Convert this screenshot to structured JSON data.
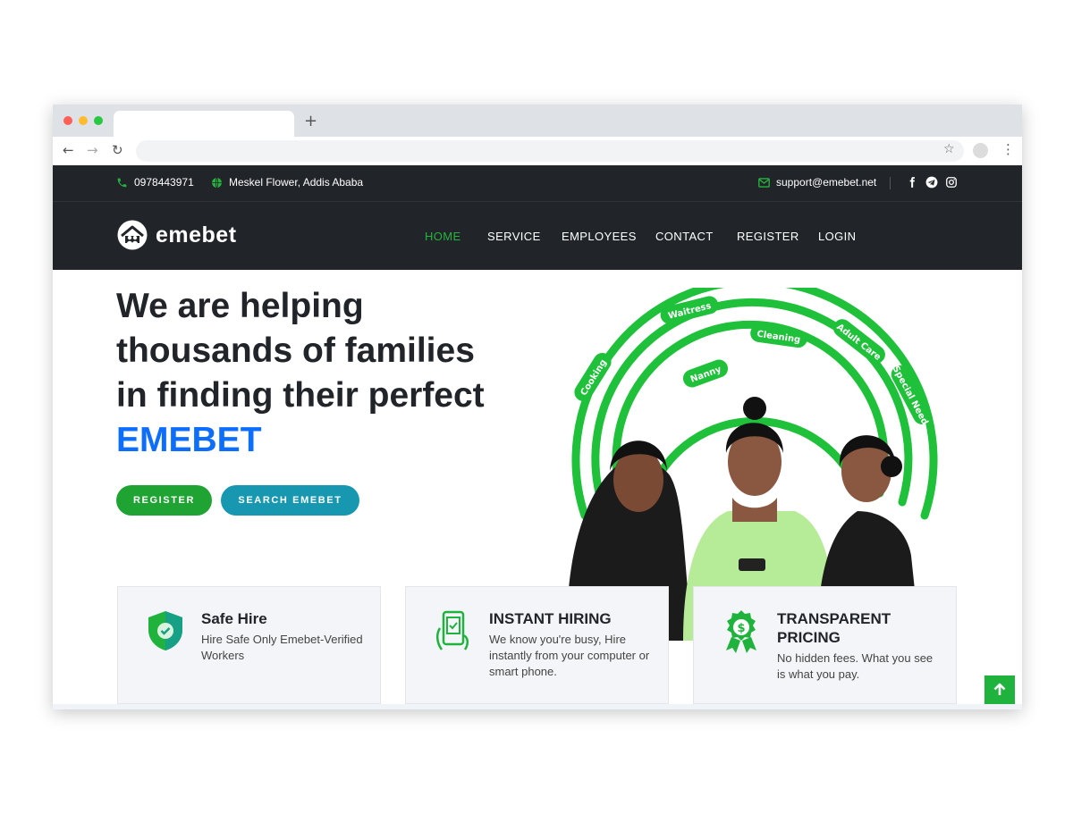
{
  "browser": {
    "new_tab": "+",
    "back": "←",
    "forward": "→",
    "reload": "↻",
    "bookmark": "☆",
    "menu": "⋮"
  },
  "topbar": {
    "phone": "0978443971",
    "location": "Meskel Flower, Addis Ababa",
    "email": "support@emebet.net",
    "social_icons": [
      "facebook-icon",
      "telegram-icon",
      "instagram-icon"
    ]
  },
  "nav": {
    "logo": "emebet",
    "items": [
      "HOME",
      "SERVICE",
      "EMPLOYEES",
      "CONTACT",
      "REGISTER",
      "LOGIN"
    ],
    "active": "HOME"
  },
  "hero": {
    "title_lines": [
      "We are helping",
      "thousands of families",
      "in finding their perfect"
    ],
    "title_brand": "EMEBET",
    "buttons": {
      "register": "REGISTER",
      "search": "SEARCH EMEBET"
    },
    "ring_labels": [
      "Waitress",
      "Cleaning",
      "Adult Care",
      "Cooking",
      "Nanny",
      "Special Need"
    ]
  },
  "features": [
    {
      "title": "Safe Hire",
      "desc": "Hire Safe Only Emebet-Verified Workers",
      "icon": "shield-check-icon"
    },
    {
      "title": "INSTANT HIRING",
      "desc": "We know you're busy, Hire instantly from your computer or smart phone.",
      "icon": "phone-hand-icon"
    },
    {
      "title": "TRANSPARENT PRICING",
      "desc": "No hidden fees. What you see is what you pay.",
      "icon": "price-badge-icon"
    }
  ],
  "colors": {
    "accent_green": "#25b33d",
    "brand_blue": "#0d6efd",
    "header_dark": "#212529",
    "search_teal": "#1798b0"
  }
}
